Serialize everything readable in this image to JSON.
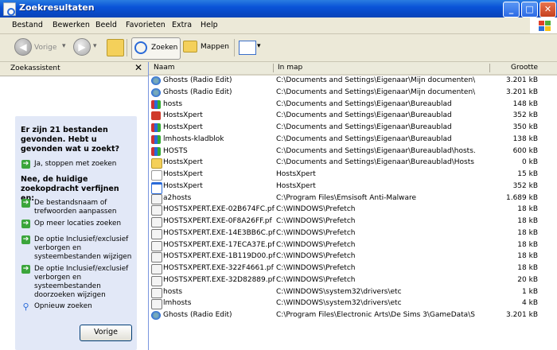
{
  "window": {
    "title": "Zoekresultaten"
  },
  "menu": [
    "Bestand",
    "Bewerken",
    "Beeld",
    "Favorieten",
    "Extra",
    "Help"
  ],
  "toolbar": {
    "back": "Vorige",
    "search": "Zoeken",
    "folders": "Mappen"
  },
  "left_panel": {
    "title": "Zoekassistent",
    "close_glyph": "✕",
    "question": "Er zijn 21 bestanden gevonden. Hebt u gevonden wat u zoekt?",
    "option_stop": "Ja, stoppen met zoeken",
    "refine_heading": "Nee, de huidige zoekopdracht verfijnen en:",
    "options": [
      "De bestandsnaam of trefwoorden aanpassen",
      "Op meer locaties zoeken",
      "De optie Inclusief/exclusief verborgen en systeembestanden wijzigen",
      "De optie Inclusief/exclusief verborgen en systeembestanden doorzoeken wijzigen"
    ],
    "new_search": "Opnieuw zoeken",
    "back_button": "Vorige"
  },
  "columns": {
    "name": "Naam",
    "folder": "In map",
    "size": "Grootte"
  },
  "rows": [
    {
      "name": "Ghosts (Radio Edit)",
      "path": "C:\\Documents and Settings\\Eigenaar\\Mijn documenten\\...",
      "size": "3.201 kB",
      "icon": "media-icon"
    },
    {
      "name": "Ghosts (Radio Edit)",
      "path": "C:\\Documents and Settings\\Eigenaar\\Mijn documenten\\...",
      "size": "3.201 kB",
      "icon": "media-icon"
    },
    {
      "name": "hosts",
      "path": "C:\\Documents and Settings\\Eigenaar\\Bureaublad",
      "size": "148 kB",
      "icon": "archive-icon"
    },
    {
      "name": "HostsXpert",
      "path": "C:\\Documents and Settings\\Eigenaar\\Bureaublad",
      "size": "352 kB",
      "icon": "pdf-icon"
    },
    {
      "name": "HostsXpert",
      "path": "C:\\Documents and Settings\\Eigenaar\\Bureaublad",
      "size": "350 kB",
      "icon": "archive-icon"
    },
    {
      "name": "lmhosts-kladblok",
      "path": "C:\\Documents and Settings\\Eigenaar\\Bureaublad",
      "size": "138 kB",
      "icon": "archive-icon"
    },
    {
      "name": "HOSTS",
      "path": "C:\\Documents and Settings\\Eigenaar\\Bureaublad\\hosts....",
      "size": "600 kB",
      "icon": "archive-icon"
    },
    {
      "name": "HostsXpert",
      "path": "C:\\Documents and Settings\\Eigenaar\\Bureaublad\\Hosts...",
      "size": "0 kB",
      "icon": "folder-icon"
    },
    {
      "name": "HostsXpert",
      "path": "HostsXpert",
      "size": "15 kB",
      "icon": "doc-icon"
    },
    {
      "name": "HostsXpert",
      "path": "HostsXpert",
      "size": "352 kB",
      "icon": "app-icon"
    },
    {
      "name": "a2hosts",
      "path": "C:\\Program Files\\Emsisoft Anti-Malware",
      "size": "1.689 kB",
      "icon": "file-icon"
    },
    {
      "name": "HOSTSXPERT.EXE-02B674FC.pf",
      "path": "C:\\WINDOWS\\Prefetch",
      "size": "18 kB",
      "icon": "file-icon"
    },
    {
      "name": "HOSTSXPERT.EXE-0F8A26FF.pf",
      "path": "C:\\WINDOWS\\Prefetch",
      "size": "18 kB",
      "icon": "file-icon"
    },
    {
      "name": "HOSTSXPERT.EXE-14E3BB6C.pf",
      "path": "C:\\WINDOWS\\Prefetch",
      "size": "18 kB",
      "icon": "file-icon"
    },
    {
      "name": "HOSTSXPERT.EXE-17ECA37E.pf",
      "path": "C:\\WINDOWS\\Prefetch",
      "size": "18 kB",
      "icon": "file-icon"
    },
    {
      "name": "HOSTSXPERT.EXE-1B119D00.pf",
      "path": "C:\\WINDOWS\\Prefetch",
      "size": "18 kB",
      "icon": "file-icon"
    },
    {
      "name": "HOSTSXPERT.EXE-322F4661.pf",
      "path": "C:\\WINDOWS\\Prefetch",
      "size": "18 kB",
      "icon": "file-icon"
    },
    {
      "name": "HOSTSXPERT.EXE-32D82889.pf",
      "path": "C:\\WINDOWS\\Prefetch",
      "size": "20 kB",
      "icon": "file-icon"
    },
    {
      "name": "hosts",
      "path": "C:\\WINDOWS\\system32\\drivers\\etc",
      "size": "1 kB",
      "icon": "file-icon"
    },
    {
      "name": "lmhosts",
      "path": "C:\\WINDOWS\\system32\\drivers\\etc",
      "size": "4 kB",
      "icon": "file-icon"
    },
    {
      "name": "Ghosts (Radio Edit)",
      "path": "C:\\Program Files\\Electronic Arts\\De Sims 3\\GameData\\S...",
      "size": "3.201 kB",
      "icon": "media-icon"
    }
  ],
  "colors": {
    "titlebar": "#0a53d8",
    "panel_bg": "#e2e8f7",
    "arrow_green": "#3ba53b"
  }
}
